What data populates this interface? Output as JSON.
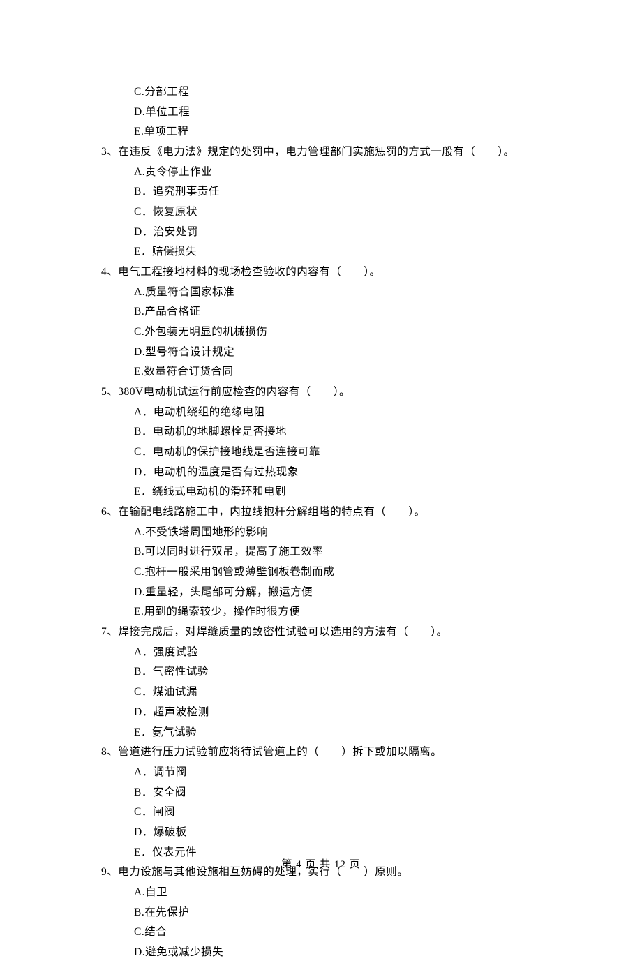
{
  "orphan_options": {
    "q2_remainder": [
      {
        "letter": "C",
        "text": "分部工程"
      },
      {
        "letter": "D",
        "text": "单位工程"
      },
      {
        "letter": "E",
        "text": "单项工程"
      }
    ]
  },
  "questions": [
    {
      "number": "3、",
      "stem": "在违反《电力法》规定的处罚中，电力管理部门实施惩罚的方式一般有（　　）。",
      "options": [
        {
          "letter": "A",
          "sep": ".",
          "text": "责令停止作业"
        },
        {
          "letter": "B",
          "sep": "．",
          "text": "追究刑事责任"
        },
        {
          "letter": "C",
          "sep": "．",
          "text": "恢复原状"
        },
        {
          "letter": "D",
          "sep": "．",
          "text": "治安处罚"
        },
        {
          "letter": "E",
          "sep": "．",
          "text": "赔偿损失"
        }
      ]
    },
    {
      "number": "4、",
      "stem": "电气工程接地材料的现场检查验收的内容有（　　）。",
      "options": [
        {
          "letter": "A",
          "sep": ".",
          "text": "质量符合国家标准"
        },
        {
          "letter": "B",
          "sep": ".",
          "text": "产品合格证"
        },
        {
          "letter": "C",
          "sep": ".",
          "text": "外包装无明显的机械损伤"
        },
        {
          "letter": "D",
          "sep": ".",
          "text": "型号符合设计规定"
        },
        {
          "letter": "E",
          "sep": ".",
          "text": "数量符合订货合同"
        }
      ]
    },
    {
      "number": "5、",
      "stem": "380V电动机试运行前应检查的内容有（　　）。",
      "options": [
        {
          "letter": "A",
          "sep": "．",
          "text": "电动机绕组的绝缘电阻"
        },
        {
          "letter": "B",
          "sep": "．",
          "text": "电动机的地脚螺栓是否接地"
        },
        {
          "letter": "C",
          "sep": "．",
          "text": "电动机的保护接地线是否连接可靠"
        },
        {
          "letter": "D",
          "sep": "．",
          "text": "电动机的温度是否有过热现象"
        },
        {
          "letter": "E",
          "sep": "．",
          "text": "绕线式电动机的滑环和电刷"
        }
      ]
    },
    {
      "number": "6、",
      "stem": "在输配电线路施工中，内拉线抱杆分解组塔的特点有（　　）。",
      "options": [
        {
          "letter": "A",
          "sep": ".",
          "text": "不受铁塔周围地形的影响"
        },
        {
          "letter": "B",
          "sep": ".",
          "text": "可以同时进行双吊，提高了施工效率"
        },
        {
          "letter": "C",
          "sep": ".",
          "text": "抱杆一般采用钢管或薄壁钢板卷制而成"
        },
        {
          "letter": "D",
          "sep": ".",
          "text": "重量轻，头尾部可分解，搬运方便"
        },
        {
          "letter": "E",
          "sep": ".",
          "text": "用到的绳索较少，操作时很方便"
        }
      ]
    },
    {
      "number": "7、",
      "stem": "焊接完成后，对焊缝质量的致密性试验可以选用的方法有（　　）。",
      "options": [
        {
          "letter": "A",
          "sep": "．",
          "text": "强度试验"
        },
        {
          "letter": "B",
          "sep": "．",
          "text": "气密性试验"
        },
        {
          "letter": "C",
          "sep": "．",
          "text": "煤油试漏"
        },
        {
          "letter": "D",
          "sep": "．",
          "text": "超声波检测"
        },
        {
          "letter": "E",
          "sep": "．",
          "text": "氨气试验"
        }
      ]
    },
    {
      "number": "8、",
      "stem": "管道进行压力试验前应将待试管道上的（　　）拆下或加以隔离。",
      "options": [
        {
          "letter": "A",
          "sep": "．",
          "text": "调节阀"
        },
        {
          "letter": "B",
          "sep": "．",
          "text": "安全阀"
        },
        {
          "letter": "C",
          "sep": "．",
          "text": "闸阀"
        },
        {
          "letter": "D",
          "sep": "．",
          "text": "爆破板"
        },
        {
          "letter": "E",
          "sep": "．",
          "text": "仪表元件"
        }
      ]
    },
    {
      "number": "9、",
      "stem": "电力设施与其他设施相互妨碍的处理，实行（　　）原则。",
      "options": [
        {
          "letter": "A",
          "sep": ".",
          "text": "自卫"
        },
        {
          "letter": "B",
          "sep": ".",
          "text": "在先保护"
        },
        {
          "letter": "C",
          "sep": ".",
          "text": "结合"
        },
        {
          "letter": "D",
          "sep": ".",
          "text": "避免或减少损失"
        }
      ]
    }
  ],
  "footer": {
    "text": "第 4 页 共 12 页"
  }
}
